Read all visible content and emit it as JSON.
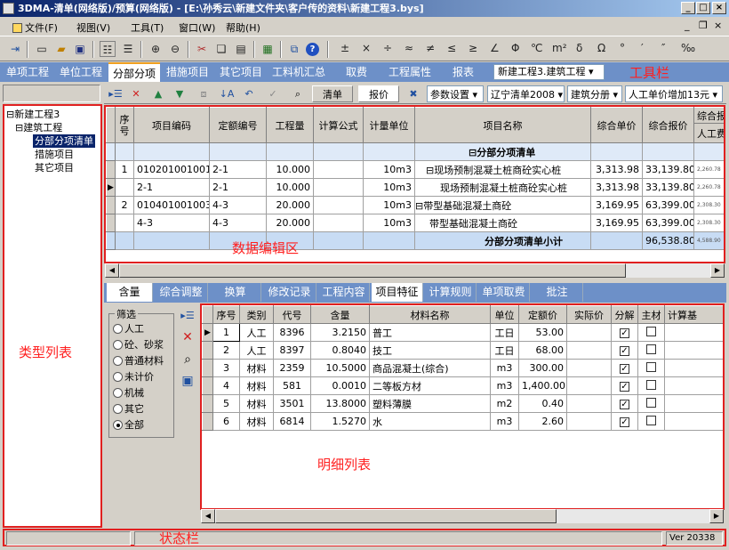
{
  "window": {
    "title": "3DMA-清单(网络版)/预算(网络版) - [E:\\孙秀云\\新建文件夹\\客户传的资料\\新建工程3.bys]"
  },
  "menu": {
    "items": [
      "文件(F)",
      "视图(V)",
      "工具(T)",
      "窗口(W)",
      "帮助(H)"
    ]
  },
  "toolbar": {
    "symbols": [
      "±",
      "×",
      "÷",
      "≈",
      "≠",
      "≤",
      "≥",
      "∠",
      "Φ",
      "℃",
      "m²",
      "δ",
      "Ω",
      "°",
      "′",
      "″",
      "‰"
    ]
  },
  "main_tabs": {
    "items": [
      "单项工程",
      "单位工程",
      "分部分项",
      "措施项目",
      "其它项目",
      "工料机汇总",
      "取费",
      "工程属性",
      "报表"
    ],
    "active": "分部分项",
    "project_select": "新建工程3.建筑工程",
    "region_label": "工具栏"
  },
  "tree": {
    "region_label": "类型列表",
    "nodes": [
      "新建工程3",
      "建筑工程",
      "分部分项清单",
      "措施项目",
      "其它项目"
    ]
  },
  "edit_toolbar": {
    "qingdan_button": "清单",
    "baojia_button": "报价",
    "param_select": "参数设置",
    "region_select": "辽宁清单2008",
    "category_select": "建筑分册",
    "labor_select": "人工单价增加13元"
  },
  "top_grid": {
    "region_label": "数据编辑区",
    "columns": [
      "序号",
      "项目编码",
      "定额编号",
      "工程量",
      "计算公式",
      "计量单位",
      "项目名称",
      "综合单价",
      "综合报价",
      "综合报",
      "人工费"
    ],
    "rows": [
      {
        "seq": "",
        "code": "",
        "quota": "",
        "qty": "",
        "formula": "",
        "unit": "",
        "name": "⊟分部分项清单",
        "unit_price": "",
        "total": "",
        "extra": ""
      },
      {
        "seq": "1",
        "code": "010201001001",
        "quota": "2-1",
        "qty": "10.000",
        "formula": "",
        "unit": "10m3",
        "name": "⊟现场预制混凝土桩商砼实心桩",
        "unit_price": "3,313.98",
        "total": "33,139.80",
        "extra": "2,260.78"
      },
      {
        "seq": "",
        "code": "2-1",
        "quota": "2-1",
        "qty": "10.000",
        "formula": "",
        "unit": "10m3",
        "name": "现场预制混凝土桩商砼实心桩",
        "unit_price": "3,313.98",
        "total": "33,139.80",
        "extra": "2,260.78"
      },
      {
        "seq": "2",
        "code": "010401001003",
        "quota": "4-3",
        "qty": "20.000",
        "formula": "",
        "unit": "10m3",
        "name": "⊟带型基础混凝土商砼",
        "unit_price": "3,169.95",
        "total": "63,399.00",
        "extra": "2,308.30"
      },
      {
        "seq": "",
        "code": "4-3",
        "quota": "4-3",
        "qty": "20.000",
        "formula": "",
        "unit": "10m3",
        "name": "带型基础混凝土商砼",
        "unit_price": "3,169.95",
        "total": "63,399.00",
        "extra": "2,308.30"
      },
      {
        "seq": "",
        "code": "",
        "quota": "",
        "qty": "",
        "formula": "",
        "unit": "",
        "name": "分部分项清单小计",
        "unit_price": "",
        "total": "96,538.80",
        "extra": "4,588.90"
      }
    ]
  },
  "detail_tabs": {
    "items": [
      "含量",
      "综合调整",
      "换算",
      "修改记录",
      "工程内容",
      "项目特征",
      "计算规则",
      "单项取费",
      "批注"
    ],
    "active": "项目特征"
  },
  "filter": {
    "legend": "筛选",
    "options": [
      "人工",
      "砼、砂浆",
      "普通材料",
      "未计价",
      "机械",
      "其它",
      "全部"
    ],
    "selected": "全部"
  },
  "detail_grid": {
    "region_label": "明细列表",
    "columns": [
      "序号",
      "类别",
      "代号",
      "含量",
      "材料名称",
      "单位",
      "定额价",
      "实际价",
      "分解",
      "主材",
      "计算基"
    ],
    "rows": [
      {
        "seq": "1",
        "type": "人工",
        "code": "8396",
        "amount": "3.2150",
        "name": "普工",
        "unit": "工日",
        "price": "53.00",
        "actual": "",
        "split": true,
        "main": false
      },
      {
        "seq": "2",
        "type": "人工",
        "code": "8397",
        "amount": "0.8040",
        "name": "技工",
        "unit": "工日",
        "price": "68.00",
        "actual": "",
        "split": true,
        "main": false
      },
      {
        "seq": "3",
        "type": "材料",
        "code": "2359",
        "amount": "10.5000",
        "name": "商品混凝土(综合)",
        "unit": "m3",
        "price": "300.00",
        "actual": "",
        "split": true,
        "main": false
      },
      {
        "seq": "4",
        "type": "材料",
        "code": "581",
        "amount": "0.0010",
        "name": "二等板方材",
        "unit": "m3",
        "price": "1,400.00",
        "actual": "",
        "split": true,
        "main": false
      },
      {
        "seq": "5",
        "type": "材料",
        "code": "3501",
        "amount": "13.8000",
        "name": "塑料薄膜",
        "unit": "m2",
        "price": "0.40",
        "actual": "",
        "split": true,
        "main": false
      },
      {
        "seq": "6",
        "type": "材料",
        "code": "6814",
        "amount": "1.5270",
        "name": "水",
        "unit": "m3",
        "price": "2.60",
        "actual": "",
        "split": true,
        "main": false
      }
    ]
  },
  "status": {
    "region_label": "状态栏",
    "version": "Ver 20338"
  }
}
